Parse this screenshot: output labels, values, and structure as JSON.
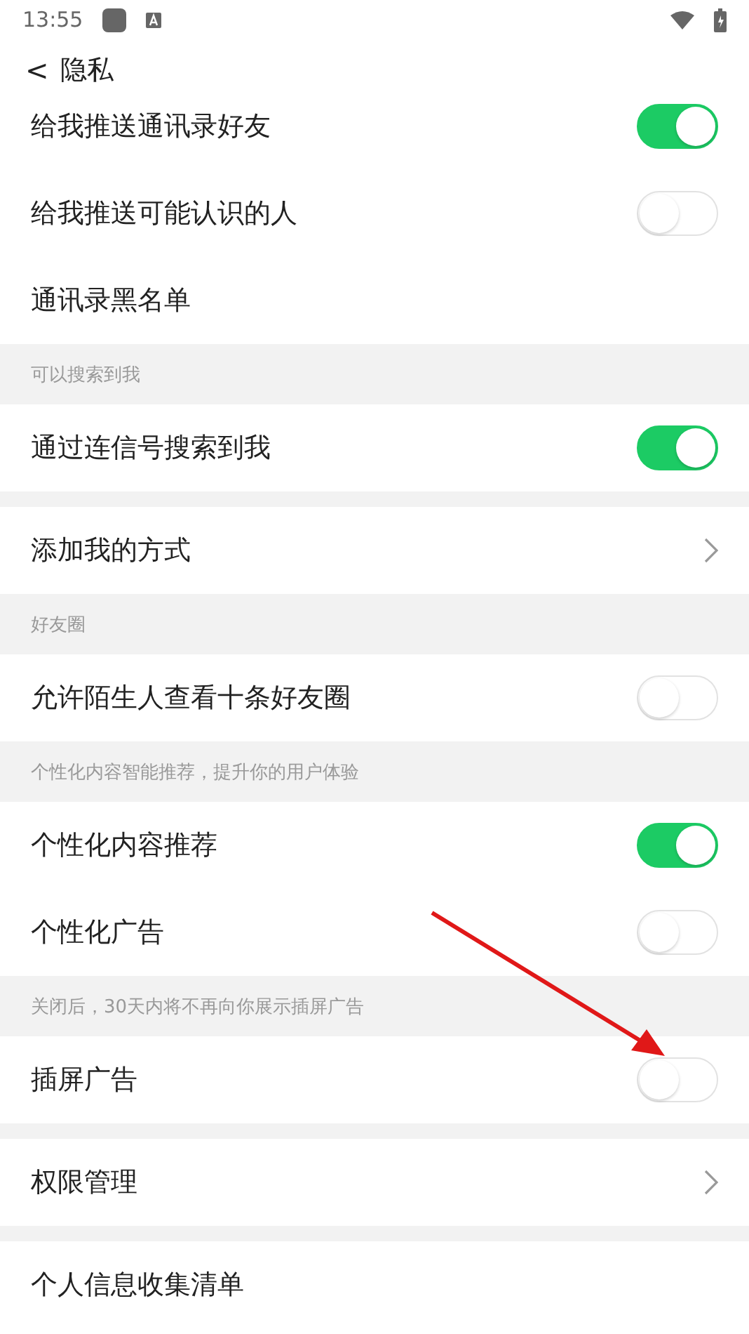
{
  "status_bar": {
    "time": "13:55"
  },
  "header": {
    "back": "<",
    "title": "隐私"
  },
  "items": [
    {
      "kind": "toggle",
      "label": "给我推送通讯录好友",
      "on": true,
      "clipped": true
    },
    {
      "kind": "toggle",
      "label": "给我推送可能认识的人",
      "on": false
    },
    {
      "kind": "plain",
      "label": "通讯录黑名单"
    },
    {
      "kind": "section",
      "label": "可以搜索到我"
    },
    {
      "kind": "toggle",
      "label": "通过连信号搜索到我",
      "on": true
    },
    {
      "kind": "gap"
    },
    {
      "kind": "link",
      "label": "添加我的方式"
    },
    {
      "kind": "section",
      "label": "好友圈"
    },
    {
      "kind": "toggle",
      "label": "允许陌生人查看十条好友圈",
      "on": false
    },
    {
      "kind": "section",
      "label": "个性化内容智能推荐，提升你的用户体验"
    },
    {
      "kind": "toggle",
      "label": "个性化内容推荐",
      "on": true
    },
    {
      "kind": "toggle",
      "label": "个性化广告",
      "on": false
    },
    {
      "kind": "section",
      "label": "关闭后，30天内将不再向你展示插屏广告"
    },
    {
      "kind": "toggle",
      "label": "插屏广告",
      "on": false
    },
    {
      "kind": "gap"
    },
    {
      "kind": "link",
      "label": "权限管理"
    },
    {
      "kind": "gap"
    },
    {
      "kind": "plain",
      "label": "个人信息收集清单"
    }
  ]
}
